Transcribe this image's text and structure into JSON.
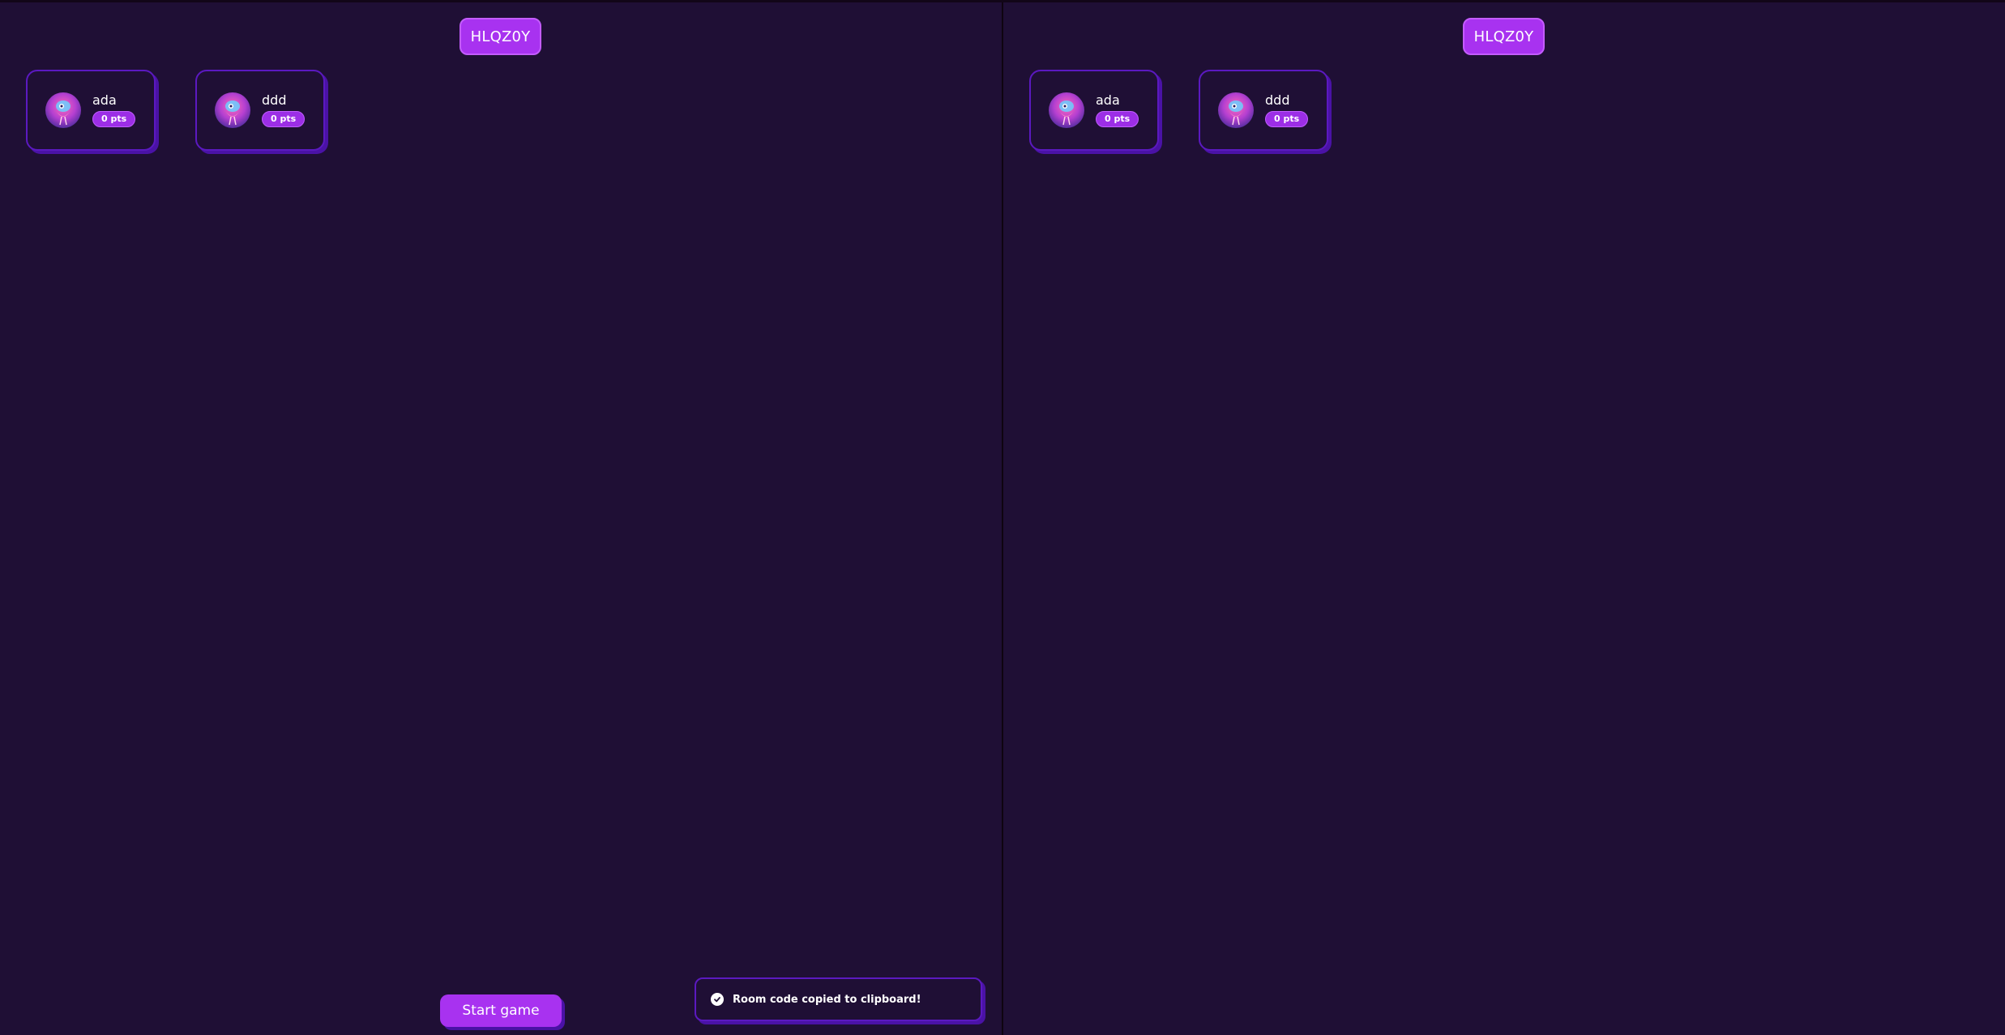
{
  "colors": {
    "background": "#1f0f35",
    "accent": "#a832f0",
    "card_border": "#5b19c0",
    "card_shadow": "#4a12a6"
  },
  "left_pane": {
    "room_code": "HLQZ0Y",
    "players": [
      {
        "name": "ada",
        "points": "0 pts",
        "avatar_icon": "flamingo-avatar-icon"
      },
      {
        "name": "ddd",
        "points": "0 pts",
        "avatar_icon": "flamingo-avatar-icon"
      }
    ],
    "start_button_label": "Start game",
    "toast": {
      "icon": "check-circle-icon",
      "message": "Room code copied to clipboard!"
    }
  },
  "right_pane": {
    "room_code": "HLQZ0Y",
    "players": [
      {
        "name": "ada",
        "points": "0 pts",
        "avatar_icon": "flamingo-avatar-icon"
      },
      {
        "name": "ddd",
        "points": "0 pts",
        "avatar_icon": "flamingo-avatar-icon"
      }
    ]
  }
}
